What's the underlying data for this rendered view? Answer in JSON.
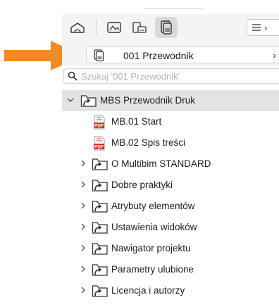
{
  "toolbar": {
    "buttons": [
      {
        "icon": "home-icon"
      },
      {
        "icon": "layout-icon"
      },
      {
        "icon": "folder-layout-icon"
      },
      {
        "icon": "publisher-set-icon",
        "active": true
      }
    ],
    "menu_icon": "list-menu-icon",
    "menu_more": "›"
  },
  "location": {
    "icon": "publisher-set-icon",
    "title": "001 Przewodnik",
    "chevron": "›"
  },
  "search": {
    "placeholder": "Szukaj '001 Przewodnik'",
    "value": ""
  },
  "tree": {
    "root": {
      "label": "MBS Przewodnik Druk",
      "expanded": true,
      "icon": "folder-shortcut-icon"
    },
    "children": [
      {
        "label": "MB.01 Start",
        "type": "pdf",
        "icon": "pdf-icon"
      },
      {
        "label": "MB.02 Spis treści",
        "type": "pdf",
        "icon": "pdf-icon"
      },
      {
        "label": "O Multibim STANDARD",
        "type": "folder",
        "icon": "folder-shortcut-icon"
      },
      {
        "label": "Dobre praktyki",
        "type": "folder",
        "icon": "folder-shortcut-icon"
      },
      {
        "label": "Atrybuty elementów",
        "type": "folder",
        "icon": "folder-shortcut-icon"
      },
      {
        "label": "Ustawienia widoków",
        "type": "folder",
        "icon": "folder-shortcut-icon"
      },
      {
        "label": "Nawigator projektu",
        "type": "folder",
        "icon": "folder-shortcut-icon"
      },
      {
        "label": "Parametry ulubione",
        "type": "folder",
        "icon": "folder-shortcut-icon"
      },
      {
        "label": "Licencja i autorzy",
        "type": "folder",
        "icon": "folder-shortcut-icon"
      }
    ]
  },
  "pdf_badge": "PDF",
  "colors": {
    "arrow": "#f08a24",
    "selected_row": "#e3e3e3",
    "pdf_red": "#d0342c",
    "toolbar_bg": "#f4f4f4"
  }
}
